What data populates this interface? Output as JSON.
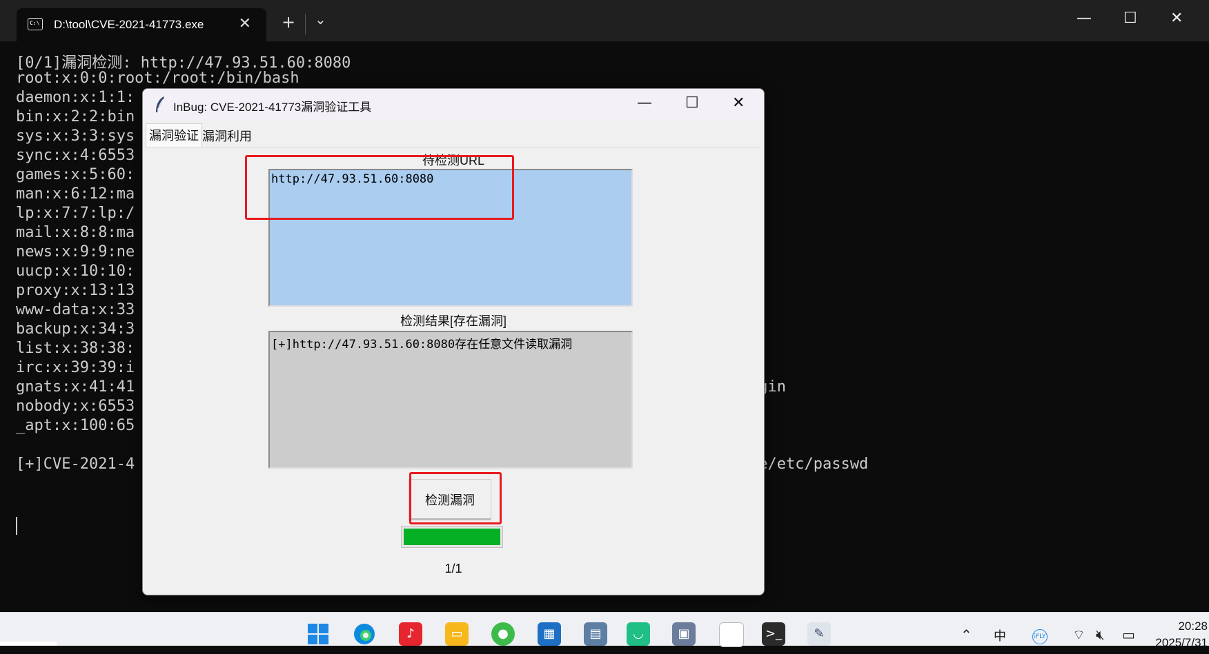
{
  "terminal": {
    "tab_title": "D:\\tool\\CVE-2021-41773.exe",
    "tab_icon": "C:\\",
    "new_tab_label": "+",
    "dropdown_label": "⌄",
    "lines": [
      "[0/1]漏洞检测: http://47.93.51.60:8080",
      "root:x:0:0:root:/root:/bin/bash",
      "daemon:x:1:1:",
      "bin:x:2:2:bin",
      "sys:x:3:3:sys",
      "sync:x:4:6553",
      "games:x:5:60:",
      "man:x:6:12:ma",
      "lp:x:7:7:lp:/",
      "mail:x:8:8:ma",
      "news:x:9:9:ne",
      "uucp:x:10:10:",
      "proxy:x:13:13",
      "www-data:x:33",
      "backup:x:34:3",
      "list:x:38:38:",
      "irc:x:39:39:i",
      "gnats:x:41:41",
      "nobody:x:6553",
      "_apt:x:100:65",
      "",
      "[+]CVE-2021-4"
    ],
    "right_fragments": {
      "gnats_tail": "ogin",
      "cve_tail": "2e/etc/passwd"
    }
  },
  "app": {
    "title": "InBug: CVE-2021-41773漏洞验证工具",
    "tabs": [
      "漏洞验证",
      "漏洞利用"
    ],
    "url_label": "待检测URL",
    "url_value": "http://47.93.51.60:8080",
    "result_label": "检测结果[存在漏洞]",
    "result_value": "[+]http://47.93.51.60:8080存在任意文件读取漏洞",
    "check_button": "检测漏洞",
    "progress": 1.0,
    "progress_color": "#06b025",
    "count": "1/1"
  },
  "taskbar": {
    "clock_time": "20:28",
    "clock_date": "2025/7/31",
    "ime_label": "中",
    "ifly_label": "iFLY"
  },
  "colors": {
    "highlight": "#e8191d",
    "url_bg": "#aacdf0",
    "result_bg": "#cccccc"
  }
}
